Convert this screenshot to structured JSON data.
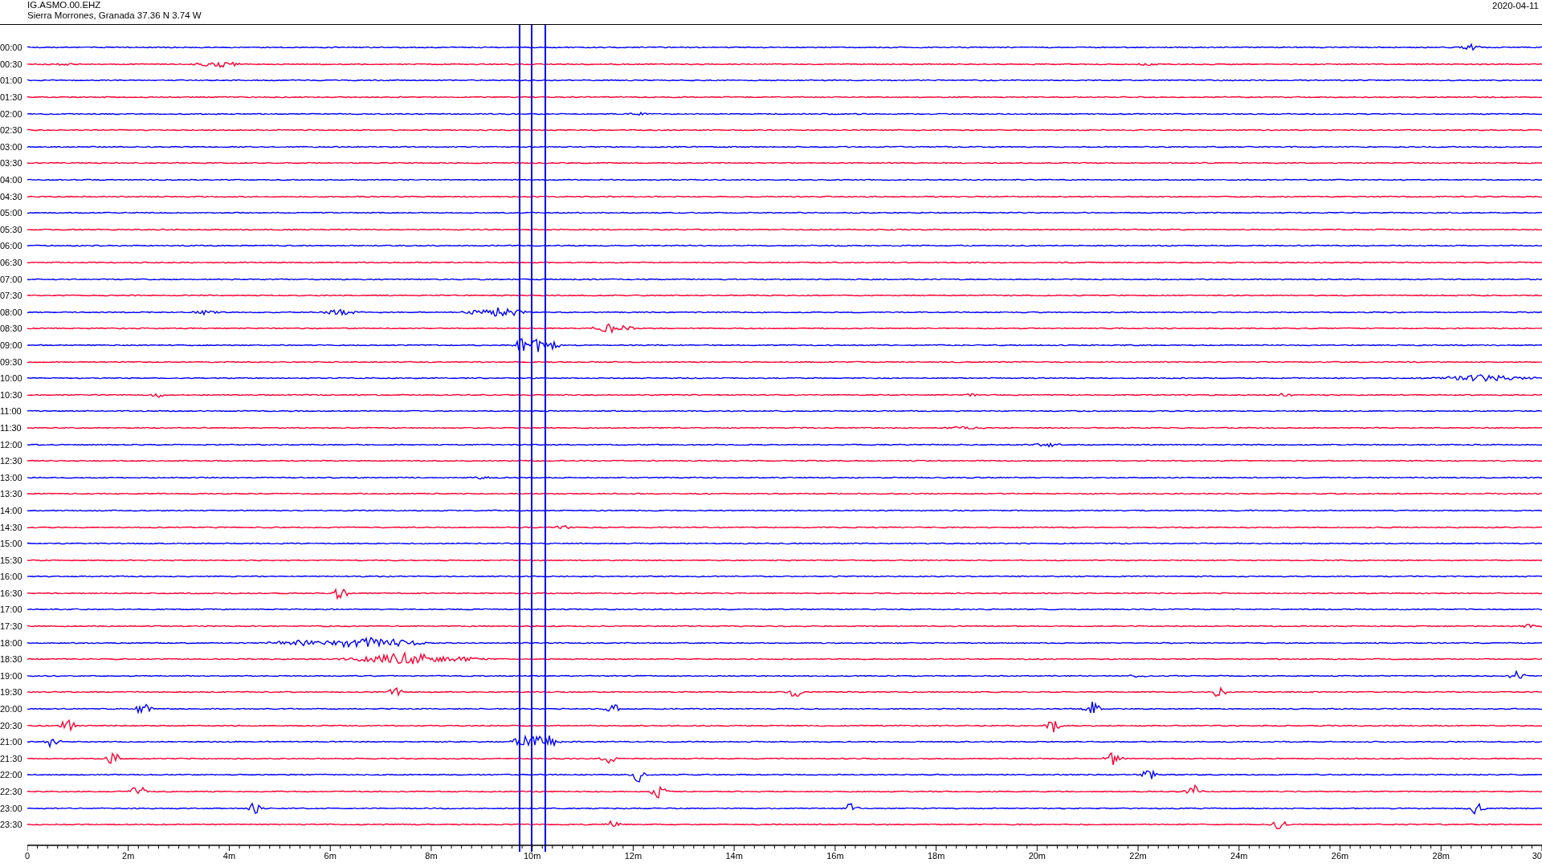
{
  "header": {
    "station": "IG.ASMO.00.EHZ",
    "location": "Sierra Morrones, Granada  37.36 N 3.74 W",
    "date": "2020-04-11"
  },
  "rows": [
    {
      "time": "00:00",
      "color": "#0000ff"
    },
    {
      "time": "00:30",
      "color": "#ff0033"
    },
    {
      "time": "01:00",
      "color": "#0000ff"
    },
    {
      "time": "01:30",
      "color": "#ff0033"
    },
    {
      "time": "02:00",
      "color": "#0000ff"
    },
    {
      "time": "02:30",
      "color": "#ff0033"
    },
    {
      "time": "03:00",
      "color": "#0000ff"
    },
    {
      "time": "03:30",
      "color": "#ff0033"
    },
    {
      "time": "04:00",
      "color": "#0000ff"
    },
    {
      "time": "04:30",
      "color": "#ff0033"
    },
    {
      "time": "05:00",
      "color": "#0000ff"
    },
    {
      "time": "05:30",
      "color": "#ff0033"
    },
    {
      "time": "06:00",
      "color": "#0000ff"
    },
    {
      "time": "06:30",
      "color": "#ff0033"
    },
    {
      "time": "07:00",
      "color": "#0000ff"
    },
    {
      "time": "07:30",
      "color": "#ff0033"
    },
    {
      "time": "08:00",
      "color": "#0000ff"
    },
    {
      "time": "08:30",
      "color": "#ff0033"
    },
    {
      "time": "09:00",
      "color": "#0000ff"
    },
    {
      "time": "09:30",
      "color": "#ff0033"
    },
    {
      "time": "10:00",
      "color": "#0000ff"
    },
    {
      "time": "10:30",
      "color": "#ff0033"
    },
    {
      "time": "11:00",
      "color": "#0000ff"
    },
    {
      "time": "11:30",
      "color": "#ff0033"
    },
    {
      "time": "12:00",
      "color": "#0000ff"
    },
    {
      "time": "12:30",
      "color": "#ff0033"
    },
    {
      "time": "13:00",
      "color": "#0000ff"
    },
    {
      "time": "13:30",
      "color": "#ff0033"
    },
    {
      "time": "14:00",
      "color": "#0000ff"
    },
    {
      "time": "14:30",
      "color": "#ff0033"
    },
    {
      "time": "15:00",
      "color": "#0000ff"
    },
    {
      "time": "15:30",
      "color": "#ff0033"
    },
    {
      "time": "16:00",
      "color": "#0000ff"
    },
    {
      "time": "16:30",
      "color": "#ff0033"
    },
    {
      "time": "17:00",
      "color": "#0000ff"
    },
    {
      "time": "17:30",
      "color": "#ff0033"
    },
    {
      "time": "18:00",
      "color": "#0000ff"
    },
    {
      "time": "18:30",
      "color": "#ff0033"
    },
    {
      "time": "19:00",
      "color": "#0000ff"
    },
    {
      "time": "19:30",
      "color": "#ff0033"
    },
    {
      "time": "20:00",
      "color": "#0000ff"
    },
    {
      "time": "20:30",
      "color": "#ff0033"
    },
    {
      "time": "21:00",
      "color": "#0000ff"
    },
    {
      "time": "21:30",
      "color": "#ff0033"
    },
    {
      "time": "22:00",
      "color": "#0000ff"
    },
    {
      "time": "22:30",
      "color": "#ff0033"
    },
    {
      "time": "23:00",
      "color": "#0000ff"
    },
    {
      "time": "23:30",
      "color": "#ff0033"
    }
  ],
  "axis": {
    "tick_labels": [
      "0",
      "2m",
      "4m",
      "6m",
      "8m",
      "10m",
      "12m",
      "14m",
      "16m",
      "18m",
      "20m",
      "22m",
      "24m",
      "26m",
      "28m",
      "30"
    ]
  }
}
